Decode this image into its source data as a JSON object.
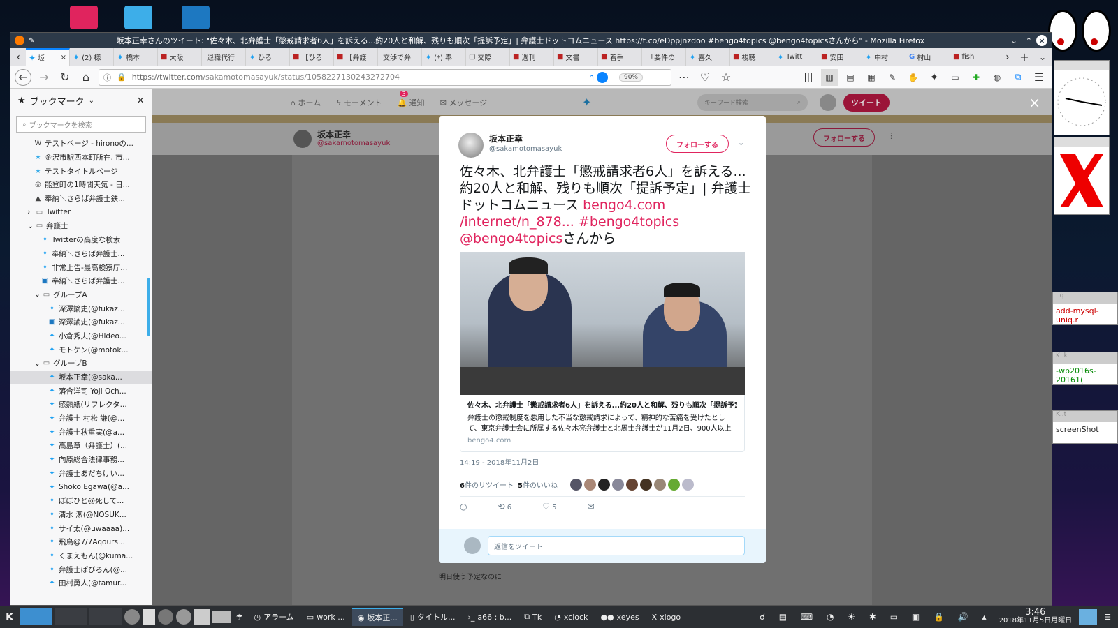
{
  "window": {
    "title": "坂本正幸さんのツイート: \"佐々木、北弁護士「懲戒請求者6人」を訴える...約20人と和解、残りも順次「提訴予定」| 弁護士ドットコムニュース https://t.co/eDppjnzdoo #bengo4topics @bengo4topicsさんから\" - Mozilla Firefox"
  },
  "tabs": [
    {
      "label": "坂",
      "icon": "twitter-icon",
      "active": true
    },
    {
      "label": "(2) 様",
      "icon": "twitter-icon"
    },
    {
      "label": "橋本",
      "icon": "twitter-icon"
    },
    {
      "label": "大阪",
      "icon": "site-icon"
    },
    {
      "label": "退職代行",
      "icon": "none"
    },
    {
      "label": "ひろ",
      "icon": "twitter-icon"
    },
    {
      "label": "【ひろ",
      "icon": "site-icon"
    },
    {
      "label": "【弁護",
      "icon": "site-icon"
    },
    {
      "label": "交渉で弁",
      "icon": "none"
    },
    {
      "label": "(*) 奉",
      "icon": "twitter-icon"
    },
    {
      "label": "交際",
      "icon": "page-icon"
    },
    {
      "label": "週刊",
      "icon": "site-icon"
    },
    {
      "label": "文書",
      "icon": "site-icon"
    },
    {
      "label": "着手",
      "icon": "site-icon"
    },
    {
      "label": "「要件の",
      "icon": "none"
    },
    {
      "label": "喜久",
      "icon": "twitter-icon"
    },
    {
      "label": "視聴",
      "icon": "site-icon"
    },
    {
      "label": "Twitt",
      "icon": "twitter-icon"
    },
    {
      "label": "安田",
      "icon": "site-icon"
    },
    {
      "label": "中村",
      "icon": "twitter-icon"
    },
    {
      "label": "村山",
      "icon": "google-icon"
    },
    {
      "label": "fish",
      "icon": "site-icon"
    }
  ],
  "navbar": {
    "url_host": "https://twitter.com",
    "url_path": "/sakamotomasayuk/status/1058227130243272704",
    "zoom": "90%",
    "toggle_label": "n"
  },
  "sidebar": {
    "title": "ブックマーク",
    "search_placeholder": "ブックマークを検索",
    "items": [
      {
        "label": "テストページ - hironoの...",
        "indent": 2,
        "icon": "W"
      },
      {
        "label": "金沢市駅西本町所在, 市...",
        "indent": 2,
        "icon": "★"
      },
      {
        "label": "テストタイトルページ",
        "indent": 2,
        "icon": "★"
      },
      {
        "label": "能登町の1時間天気 - 日...",
        "indent": 2,
        "icon": "◎"
      },
      {
        "label": "奉納＼さらば弁護士鉄...",
        "indent": 2,
        "icon": "▲"
      },
      {
        "label": "Twitter",
        "indent": 1,
        "icon": "folder",
        "toggle": "›"
      },
      {
        "label": "弁護士",
        "indent": 1,
        "icon": "folder",
        "toggle": "⌄"
      },
      {
        "label": "Twitterの高度な検索",
        "indent": 3,
        "icon": "bird"
      },
      {
        "label": "奉納＼さらば弁護士...",
        "indent": 3,
        "icon": "bird"
      },
      {
        "label": "非常上告-最高検察庁...",
        "indent": 3,
        "icon": "bird"
      },
      {
        "label": "奉納＼さらば弁護士...",
        "indent": 3,
        "icon": "blog"
      },
      {
        "label": "グループA",
        "indent": 2,
        "icon": "folder",
        "toggle": "⌄"
      },
      {
        "label": "深澤諭史(@fukaz...",
        "indent": 4,
        "icon": "bird"
      },
      {
        "label": "深澤諭史(@fukaz...",
        "indent": 4,
        "icon": "blog"
      },
      {
        "label": "小倉秀夫(@Hideo...",
        "indent": 4,
        "icon": "bird"
      },
      {
        "label": "モトケン(@motok...",
        "indent": 4,
        "icon": "bird"
      },
      {
        "label": "グループB",
        "indent": 2,
        "icon": "folder",
        "toggle": "⌄"
      },
      {
        "label": "坂本正幸(@saka...",
        "indent": 4,
        "icon": "bird",
        "selected": true
      },
      {
        "label": "落合洋司 Yoji Och...",
        "indent": 4,
        "icon": "bird"
      },
      {
        "label": "感熱紙(リフレクタ...",
        "indent": 4,
        "icon": "bird"
      },
      {
        "label": "弁護士 村松 謙(@...",
        "indent": 4,
        "icon": "bird"
      },
      {
        "label": "弁護士秋重実(@a...",
        "indent": 4,
        "icon": "bird"
      },
      {
        "label": "高島章（弁護士）(...",
        "indent": 4,
        "icon": "bird"
      },
      {
        "label": "向原総合法律事務...",
        "indent": 4,
        "icon": "bird"
      },
      {
        "label": "弁護士あだちけい...",
        "indent": 4,
        "icon": "bird"
      },
      {
        "label": "Shoko Egawa(@a...",
        "indent": 4,
        "icon": "bird"
      },
      {
        "label": "ぼぼひと@死して...",
        "indent": 4,
        "icon": "bird"
      },
      {
        "label": "清水 潔(@NOSUK...",
        "indent": 4,
        "icon": "bird"
      },
      {
        "label": "サイ太(@uwaaaa)...",
        "indent": 4,
        "icon": "bird"
      },
      {
        "label": "飛鳥@7/7Aqours...",
        "indent": 4,
        "icon": "bird"
      },
      {
        "label": "くまえもん(@kuma...",
        "indent": 4,
        "icon": "bird"
      },
      {
        "label": "弁護士ぱびろん(@...",
        "indent": 4,
        "icon": "bird"
      },
      {
        "label": "田村勇人(@tamur...",
        "indent": 4,
        "icon": "bird"
      }
    ]
  },
  "twitter_nav": {
    "home": "ホーム",
    "moments": "モーメント",
    "notifications": "通知",
    "notif_count": "3",
    "messages": "メッセージ",
    "search_placeholder": "キーワード検索",
    "tweet_button": "ツイート"
  },
  "profile": {
    "name": "坂本正幸",
    "handle": "@sakamotomasayuk",
    "follow": "フォローする"
  },
  "modal": {
    "name": "坂本正幸",
    "handle": "@sakamotomasayuk",
    "follow": "フォローする",
    "text_main": "佐々木、北弁護士「懲戒請求者6人」を訴える...約20人と和解、残りも順次「提訴予定」| 弁護士ドットコムニュース ",
    "link1": "bengo4.com /internet/n_878...",
    "hashtag": " #bengo4topics",
    "mention": "@bengo4topics",
    "suffix": "さんから",
    "card_title": "佐々木、北弁護士「懲戒請求者6人」を訴える...約20人と和解、残りも順次「提訴予定」",
    "card_desc": "弁護士の懲戒制度を悪用した不当な懲戒請求によって、精神的な苦痛を受けたとして、東京弁護士会に所属する佐々木亮弁護士と北周士弁護士が11月2日、900人以上の...",
    "card_domain": "bengo4.com",
    "timestamp": "14:19 - 2018年11月2日",
    "retweets_num": "6",
    "retweets_label": "件のリツイート",
    "likes_num": "5",
    "likes_label": "件のいいね",
    "retweet_count": "6",
    "like_count": "5",
    "reply_placeholder": "返信をツイート"
  },
  "bg_reply": {
    "line1": "明日使う予定なのに"
  },
  "taskbar": {
    "items": [
      {
        "label": "アラーム",
        "icon": "alarm-icon"
      },
      {
        "label": "work ...",
        "icon": "folder-icon"
      },
      {
        "label": "坂本正...",
        "icon": "firefox-icon",
        "active": true
      },
      {
        "label": "タイトル...",
        "icon": "doc-icon"
      },
      {
        "label": "a66 : b...",
        "icon": "terminal-icon"
      },
      {
        "label": "Tk",
        "icon": "tk-icon"
      },
      {
        "label": "xclock",
        "icon": "clock-icon"
      },
      {
        "label": "xeyes",
        "icon": "eyes-icon"
      },
      {
        "label": "xlogo",
        "icon": "x-icon"
      }
    ],
    "time": "3:46",
    "date": "2018年11月5日月曜日"
  },
  "right_windows": [
    {
      "title": "..q",
      "text": "add-mysql-uniq.r"
    },
    {
      "title": "K..k",
      "text": "-wp2016s-20161("
    },
    {
      "title": "K..t",
      "text": "screenShot"
    }
  ],
  "colors": {
    "accent": "#e0245e",
    "twitter_blue": "#1da1f2",
    "titlebar": "#2d3a49"
  }
}
